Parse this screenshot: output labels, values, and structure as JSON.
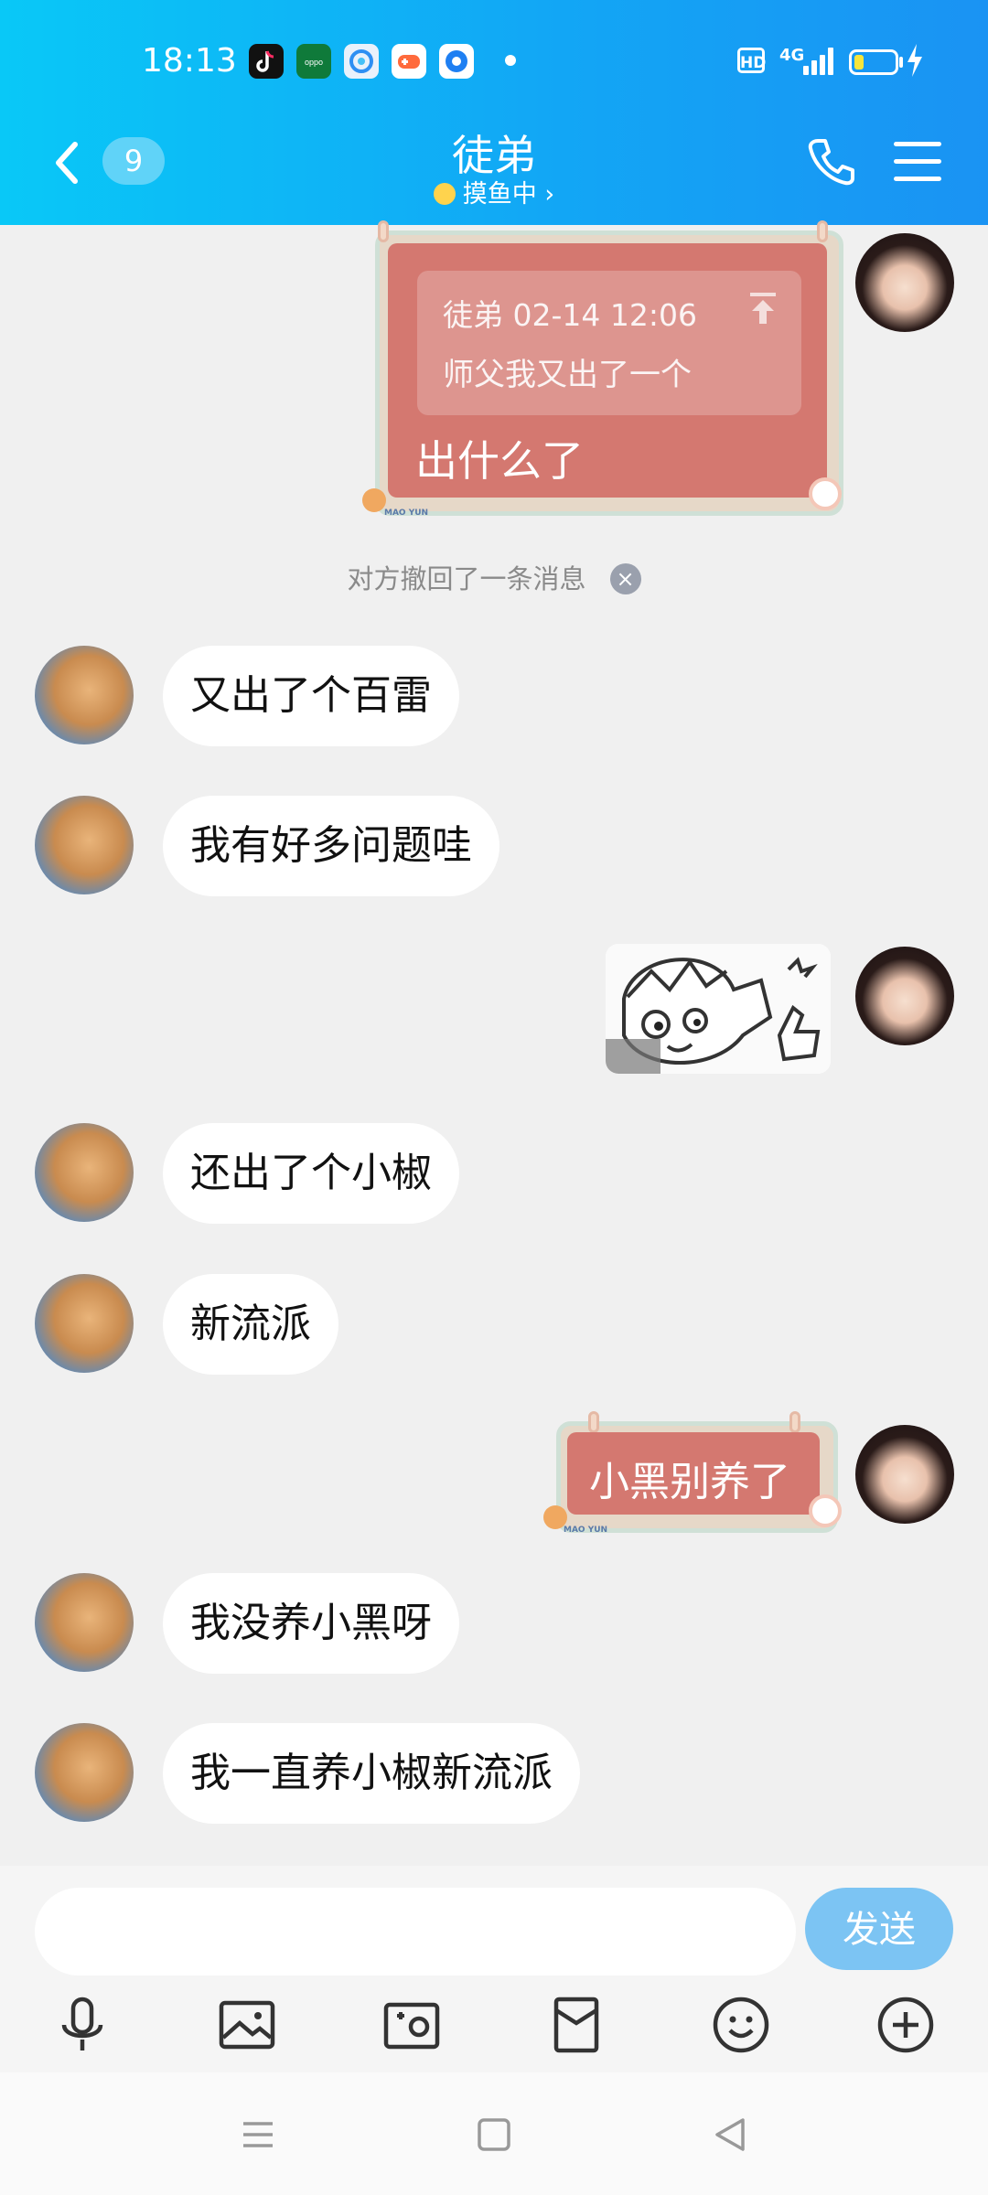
{
  "status_bar": {
    "time": "18:13",
    "apps": [
      "tiktok-icon",
      "oppo-icon",
      "qq-browser-icon",
      "game-center-icon",
      "camera-app-icon"
    ],
    "hd": "HD",
    "network": "4G"
  },
  "header": {
    "unread_count": "9",
    "title": "徒弟",
    "subtitle": "摸鱼中",
    "subtitle_chevron": "›"
  },
  "messages": {
    "m1_quote_meta": "徒弟 02-14 12:06",
    "m1_quote_text": "师父我又出了一个",
    "m1_text": "出什么了",
    "recall_notice": "对方撤回了一条消息",
    "recall_close": "×",
    "m2": "又出了个百雷",
    "m3": "我有好多问题哇",
    "m4": "还出了个小椒",
    "m5": "新流派",
    "m6": "小黑别养了",
    "m7": "我没养小黑呀",
    "m8": "我一直养小椒新流派",
    "badge_text": "MAO YUN"
  },
  "input": {
    "value": "",
    "placeholder": "",
    "send_label": "发送"
  },
  "colors": {
    "header_start": "#09c8f7",
    "header_end": "#1a93f3",
    "theme_bubble": "#d47870",
    "send_button": "#7cc4f3"
  },
  "icons": {
    "toolbar": [
      "microphone-icon",
      "image-icon",
      "camera-icon",
      "red-packet-icon",
      "emoji-icon",
      "plus-icon"
    ],
    "nav": [
      "recent-apps-icon",
      "home-icon",
      "back-icon"
    ]
  }
}
